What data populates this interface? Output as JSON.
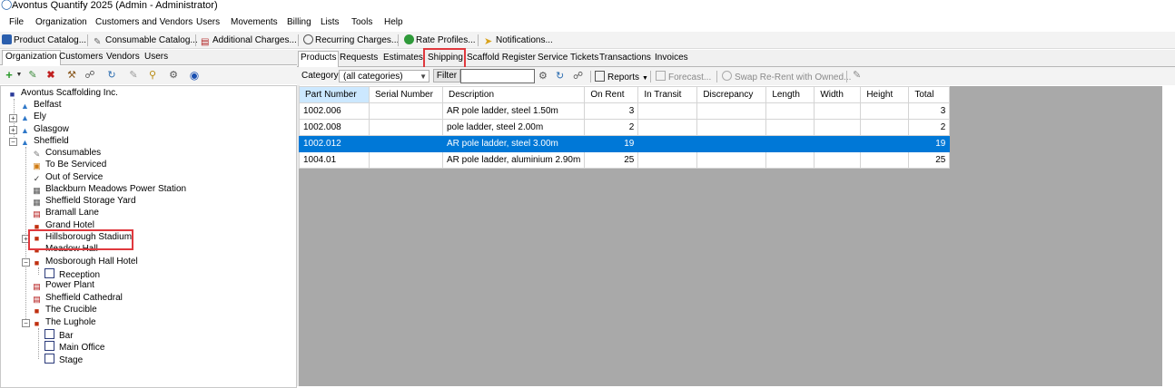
{
  "window": {
    "title": "Avontus Quantify 2025 (Admin - Administrator)"
  },
  "menu": [
    "File",
    "Organization",
    "Customers and Vendors",
    "Users",
    "Movements",
    "Billing",
    "Lists",
    "Tools",
    "Help"
  ],
  "toolbar": {
    "product_catalog": "Product Catalog...",
    "consumable_catalog": "Consumable Catalog...",
    "additional_charges": "Additional Charges...",
    "recurring_charges": "Recurring Charges...",
    "rate_profiles": "Rate Profiles...",
    "notifications": "Notifications..."
  },
  "left_tabs": [
    "Organization",
    "Customers",
    "Vendors",
    "Users"
  ],
  "tree": {
    "root": "Avontus Scaffolding Inc.",
    "nodes": [
      "Belfast",
      "Ely",
      "Glasgow",
      "Sheffield",
      "Consumables",
      "To Be Serviced",
      "Out of Service",
      "Blackburn Meadows Power Station",
      "Sheffield Storage Yard",
      "Bramall Lane",
      "Grand Hotel",
      "Hillsborough Stadium",
      "Meadow Hall",
      "Mosborough Hall Hotel",
      "Reception",
      "Power Plant",
      "Sheffield Cathedral",
      "The Crucible",
      "The Lughole",
      "Bar",
      "Main Office",
      "Stage"
    ]
  },
  "right_tabs": [
    "Products",
    "Requests",
    "Estimates",
    "Shipping",
    "Scaffold Register",
    "Service Tickets",
    "Transactions",
    "Invoices"
  ],
  "filterbar": {
    "category_label": "Category",
    "category_value": "(all categories)",
    "filter_button": "Filter",
    "reports": "Reports",
    "forecast": "Forecast...",
    "swap": "Swap Re-Rent with Owned..."
  },
  "grid": {
    "columns": [
      "Part Number",
      "Serial Number",
      "Description",
      "On Rent",
      "In Transit",
      "Discrepancy",
      "Length",
      "Width",
      "Height",
      "Total"
    ],
    "rows": [
      [
        "1002.006",
        "",
        "AR pole ladder, steel 1.50m",
        "3",
        "",
        "",
        "",
        "",
        "",
        "3"
      ],
      [
        "1002.008",
        "",
        "pole ladder, steel 2.00m",
        "2",
        "",
        "",
        "",
        "",
        "",
        "2"
      ],
      [
        "1002.012",
        "",
        "AR pole ladder, steel 3.00m",
        "19",
        "",
        "",
        "",
        "",
        "",
        "19"
      ],
      [
        "1004.01",
        "",
        "AR pole ladder, aluminium 2.90m",
        "25",
        "",
        "",
        "",
        "",
        "",
        "25"
      ]
    ],
    "selected_row": 2
  },
  "colors": {
    "selection": "#0078d7",
    "highlight_box": "#e0393e",
    "grid_background": "#a9a9a9"
  }
}
